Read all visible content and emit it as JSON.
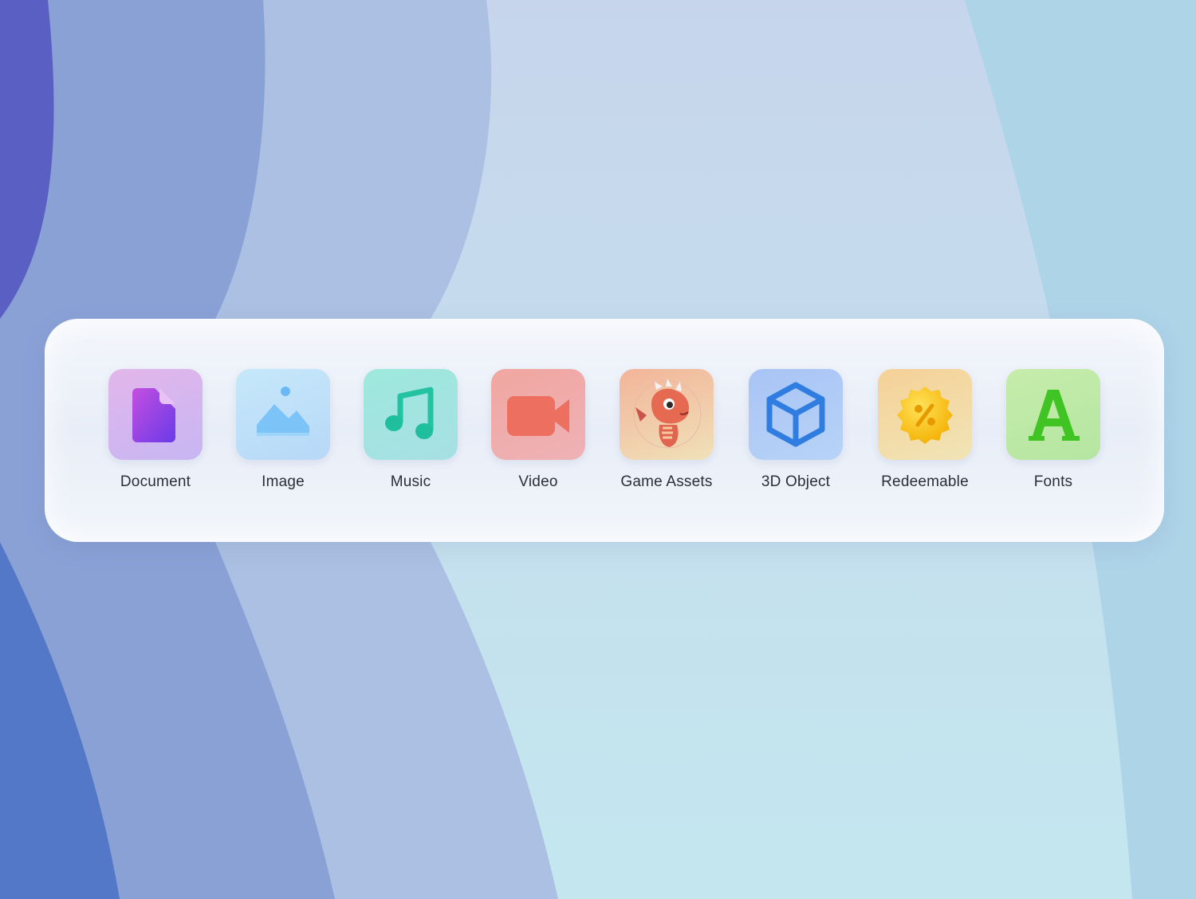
{
  "categories": [
    {
      "label": "Document",
      "icon": "document-icon",
      "color_top": "#e2b6ea",
      "color_bottom": "#c7b6f3",
      "accent": "#7b3de0"
    },
    {
      "label": "Image",
      "icon": "image-icon",
      "color_top": "#bfe4f8",
      "color_bottom": "#b7d8f7",
      "accent": "#5fb4f5"
    },
    {
      "label": "Music",
      "icon": "music-note-icon",
      "color_top": "#9de9dd",
      "color_bottom": "#a8dfe4",
      "accent": "#1fbf9d"
    },
    {
      "label": "Video",
      "icon": "video-camera-icon",
      "color_top": "#f1a6a0",
      "color_bottom": "#eeb2b6",
      "accent": "#e86e5f"
    },
    {
      "label": "Game Assets",
      "icon": "dragon-icon",
      "color_top": "#f2b49a",
      "color_bottom": "#f0e1b8",
      "accent": "#e0644e"
    },
    {
      "label": "3D Object",
      "icon": "cube-icon",
      "color_top": "#a8c4f5",
      "color_bottom": "#b8d3f7",
      "accent": "#2f7de0"
    },
    {
      "label": "Redeemable",
      "icon": "discount-badge-icon",
      "color_top": "#f5d197",
      "color_bottom": "#f1e4b6",
      "accent": "#f5b800"
    },
    {
      "label": "Fonts",
      "icon": "letter-a-icon",
      "color_top": "#c6ecaa",
      "color_bottom": "#b5e6a2",
      "accent": "#3fc424"
    }
  ]
}
